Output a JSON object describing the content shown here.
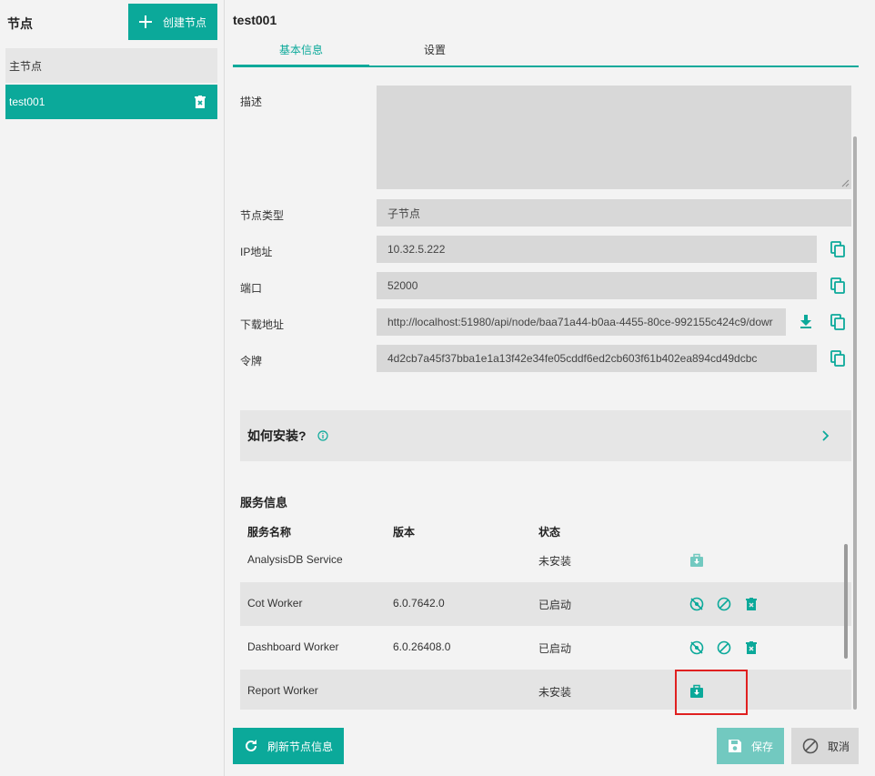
{
  "colors": {
    "accent": "#0ba99a",
    "accent_light": "#72c9c0",
    "highlight": "#e02020"
  },
  "left": {
    "title": "节点",
    "create_label": "创建节点",
    "nodes": [
      {
        "label": "主节点"
      },
      {
        "label": "test001",
        "selected": true
      }
    ]
  },
  "right": {
    "title": "test001",
    "tabs": [
      {
        "label": "基本信息",
        "active": true
      },
      {
        "label": "设置"
      }
    ],
    "fields": {
      "desc_label": "描述",
      "desc_value": "",
      "type_label": "节点类型",
      "type_value": "子节点",
      "ip_label": "IP地址",
      "ip_value": "10.32.5.222",
      "port_label": "端口",
      "port_value": "52000",
      "download_label": "下载地址",
      "download_value": "http://localhost:51980/api/node/baa71a44-b0aa-4455-80ce-992155c424c9/dowr",
      "token_label": "令牌",
      "token_value": "4d2cb7a45f37bba1e1a13f42e34fe05cddf6ed2cb603f61b402ea894cd49dcbc"
    },
    "install": {
      "label": "如何安装?"
    },
    "services": {
      "title": "服务信息",
      "headers": {
        "name": "服务名称",
        "version": "版本",
        "status": "状态"
      },
      "rows": [
        {
          "name": "AnalysisDB Service",
          "version": "",
          "status": "未安装",
          "actions": [
            "install-icon"
          ]
        },
        {
          "name": "Cot Worker",
          "version": "6.0.7642.0",
          "status": "已启动",
          "actions": [
            "stop-icon",
            "disable-icon",
            "delete-icon"
          ]
        },
        {
          "name": "Dashboard Worker",
          "version": "6.0.26408.0",
          "status": "已启动",
          "actions": [
            "stop-icon",
            "disable-icon",
            "delete-icon"
          ]
        },
        {
          "name": "Report Worker",
          "version": "",
          "status": "未安装",
          "actions": [
            "install-icon"
          ]
        }
      ]
    },
    "buttons": {
      "refresh": "刷新节点信息",
      "save": "保存",
      "cancel": "取消"
    }
  }
}
